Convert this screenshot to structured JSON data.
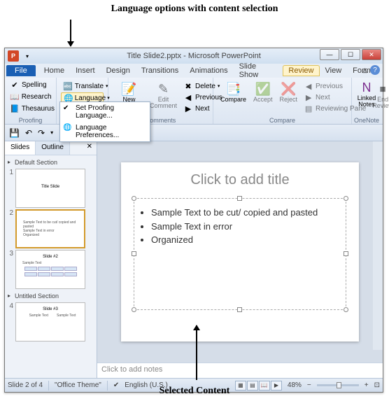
{
  "annotations": {
    "top": "Language options with content selection",
    "bottom": "Selected Content"
  },
  "titlebar": {
    "app_letter": "P",
    "title": "Title Slide2.pptx - Microsoft PowerPoint"
  },
  "menu": {
    "file": "File",
    "items": [
      "Home",
      "Insert",
      "Design",
      "Transitions",
      "Animations",
      "Slide Show",
      "Review",
      "View",
      "Format"
    ],
    "active": "Review"
  },
  "ribbon": {
    "proofing": {
      "label": "Proofing",
      "spelling": "Spelling",
      "research": "Research",
      "thesaurus": "Thesaurus"
    },
    "language": {
      "label": "Language",
      "translate": "Translate",
      "language": "Language",
      "dropdown": {
        "set_proofing": "Set Proofing Language...",
        "preferences": "Language Preferences..."
      }
    },
    "comments": {
      "label": "Comments",
      "new": "New Comment",
      "edit": "Edit Comment",
      "delete": "Delete",
      "previous": "Previous",
      "next": "Next"
    },
    "compare": {
      "label": "Compare",
      "compare": "Compare",
      "accept": "Accept",
      "reject": "Reject",
      "previous": "Previous",
      "next": "Next",
      "reviewing_pane": "Reviewing Pane",
      "end_review": "End Review"
    },
    "onenote": {
      "label": "OneNote",
      "linked_notes": "Linked Notes"
    }
  },
  "slide_panel": {
    "tabs": {
      "slides": "Slides",
      "outline": "Outline"
    },
    "sections": {
      "default": "Default Section",
      "untitled": "Untitled Section"
    },
    "thumbs": {
      "t1": {
        "title": "Title Slide"
      },
      "t2": {
        "l1": "Sample Text to be cut/ copied and pasted",
        "l2": "Sample Text in error",
        "l3": "Organized"
      },
      "t3": {
        "title": "Slide #2",
        "line": "Sample Text"
      },
      "t4": {
        "title": "Slide #3",
        "l1": "Sample Text",
        "l2": "Sample Text"
      }
    }
  },
  "slide": {
    "title_placeholder": "Click to add title",
    "bullets": [
      "Sample Text to be cut/ copied and pasted",
      "Sample Text in error",
      "Organized"
    ]
  },
  "notes_placeholder": "Click to add notes",
  "statusbar": {
    "slide_info": "Slide 2 of 4",
    "theme": "\"Office Theme\"",
    "language": "English (U.S.)",
    "zoom": "48%"
  }
}
